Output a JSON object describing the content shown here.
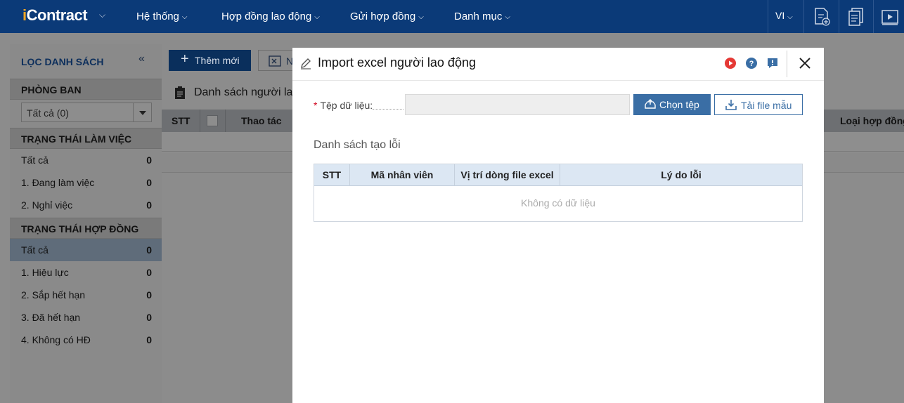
{
  "app": {
    "logo_prefix": "i",
    "logo_text": "Contract",
    "nav": [
      "Hệ thống",
      "Hợp đồng lao động",
      "Gửi hợp đồng",
      "Danh mục"
    ],
    "language": "VI"
  },
  "sidebar": {
    "title": "LỌC DANH SÁCH",
    "department_label": "PHÒNG BAN",
    "department_value": "Tất cả (0)",
    "work_status_label": "TRẠNG THÁI LÀM VIỆC",
    "work_status": [
      {
        "label": "Tất cả",
        "count": "0"
      },
      {
        "label": "1. Đang làm việc",
        "count": "0"
      },
      {
        "label": "2. Nghỉ việc",
        "count": "0"
      }
    ],
    "contract_status_label": "TRẠNG THÁI HỢP ĐỒNG",
    "contract_status": [
      {
        "label": "Tất cả",
        "count": "0"
      },
      {
        "label": "1. Hiệu lực",
        "count": "0"
      },
      {
        "label": "2. Sắp hết hạn",
        "count": "0"
      },
      {
        "label": "3. Đã hết hạn",
        "count": "0"
      },
      {
        "label": "4. Không có HĐ",
        "count": "0"
      }
    ]
  },
  "toolbar": {
    "add_label": "Thêm mới",
    "import_label_partial": "N"
  },
  "list": {
    "title_partial": "Danh sách người lao",
    "columns": [
      "STT",
      "Thao tác",
      "Loại hợp đồng"
    ]
  },
  "modal": {
    "title": "Import excel người lao động",
    "file_label": "Tệp dữ liệu:",
    "required_mark": "*",
    "file_value": "",
    "choose_button": "Chọn tệp",
    "template_button": "Tải file mẫu",
    "error_section_title": "Danh sách tạo lỗi",
    "error_columns": [
      "STT",
      "Mã nhân viên",
      "Vị trí dòng file excel",
      "Lý do lỗi"
    ],
    "empty_text": "Không có dữ liệu"
  },
  "colors": {
    "nav_bg": "#0b3a78",
    "primary": "#3a6ea5",
    "help_icon": "#3a6ea5",
    "video_icon": "#e53935"
  }
}
